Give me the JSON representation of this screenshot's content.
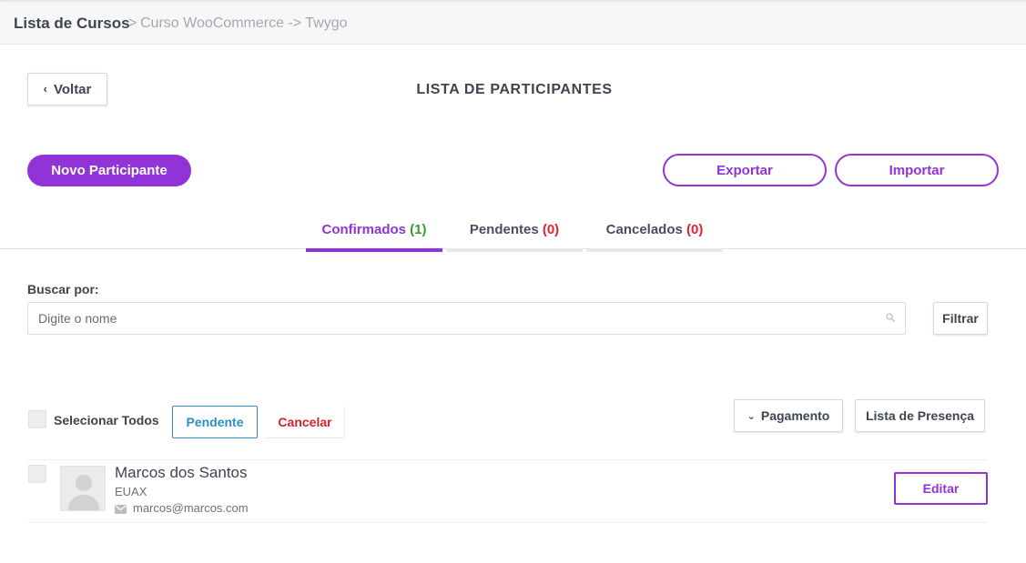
{
  "breadcrumb": {
    "root": "Lista de Cursos",
    "separator": ">",
    "current": "Curso WooCommerce -> Twygo"
  },
  "header": {
    "back_label": "Voltar",
    "back_icon": "chevron-left-icon",
    "title": "LISTA DE PARTICIPANTES"
  },
  "actions": {
    "new_participant": "Novo Participante",
    "export": "Exportar",
    "import": "Importar"
  },
  "tabs": [
    {
      "label": "Confirmados",
      "count": "(1)",
      "active": true
    },
    {
      "label": "Pendentes",
      "count": "(0)",
      "active": false
    },
    {
      "label": "Cancelados",
      "count": "(0)",
      "active": false
    }
  ],
  "search": {
    "label": "Buscar por:",
    "placeholder": "Digite o nome",
    "value": "",
    "icon": "search-icon",
    "filter_label": "Filtrar"
  },
  "bulk": {
    "select_all": "Selecionar Todos",
    "pending": "Pendente",
    "cancel": "Cancelar",
    "payment": "Pagamento",
    "payment_icon": "chevron-down-icon",
    "attendance": "Lista de Presença"
  },
  "participants": [
    {
      "name": "Marcos dos Santos",
      "organization": "EUAX",
      "email": "marcos@marcos.com",
      "email_icon": "envelope-icon",
      "avatar_icon": "user-silhouette-icon",
      "edit_label": "Editar"
    }
  ],
  "colors": {
    "accent": "#9133d6",
    "confirmed_count": "#2f9d2f",
    "zero_count": "#e3202f",
    "pending_button": "#2d8fc7",
    "cancel_button": "#d0222f"
  }
}
